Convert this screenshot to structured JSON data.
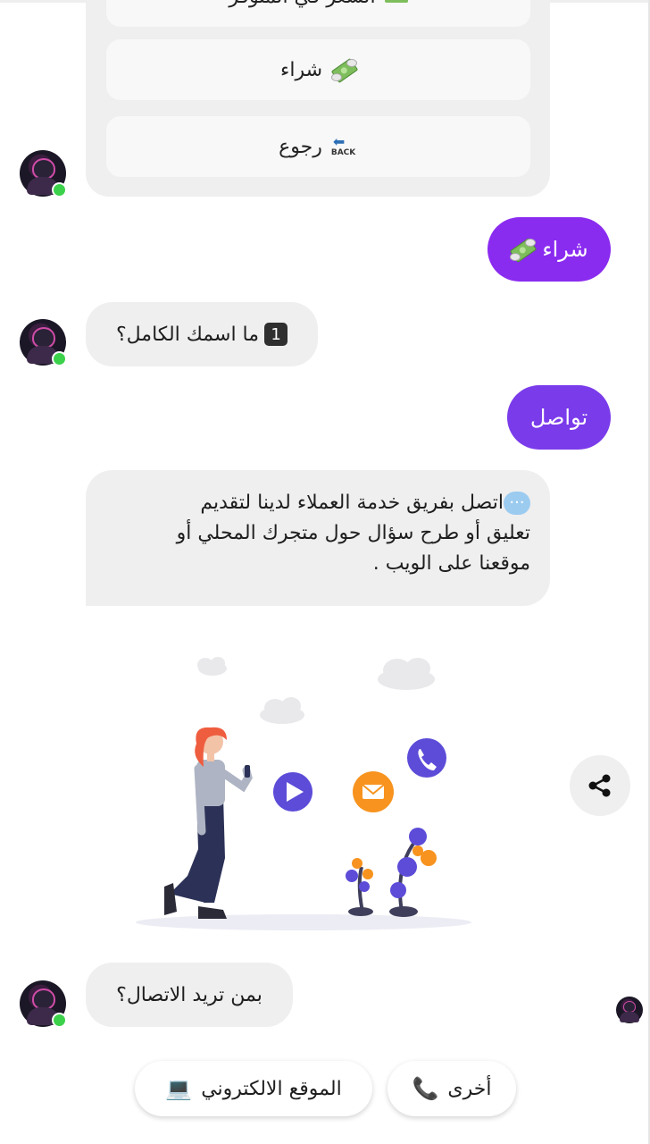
{
  "colors": {
    "outgoing_bubble": "#8a2bf0",
    "incoming_bubble": "#efefef",
    "online_dot": "#3bd14a"
  },
  "menu_card": {
    "partial_item_label": "السعر في المتوفر",
    "items": [
      {
        "label": "شراء",
        "icon": "flying-money-icon"
      },
      {
        "label": "رجوع",
        "icon": "back-arrow-icon"
      }
    ]
  },
  "messages": [
    {
      "from": "user",
      "text": "شراء",
      "icon": "flying-money-icon"
    },
    {
      "from": "bot",
      "text": "ما اسمك الكامل؟",
      "badge": "1"
    },
    {
      "from": "user",
      "text": "تواصل"
    },
    {
      "from": "bot",
      "text_lines": [
        "اتصل بفريق خدمة العملاء لدينا لتقديم",
        "تعليق أو طرح سؤال حول متجرك المحلي أو",
        "موقعنا على الويب ."
      ],
      "icon": "speech-bubble-icon"
    },
    {
      "from": "bot",
      "text": "بمن تريد الاتصال؟"
    }
  ],
  "quick_replies": [
    {
      "label": "أخرى",
      "icon": "telephone-icon"
    },
    {
      "label": "الموقع الالكتروني",
      "icon": "laptop-icon"
    }
  ],
  "share": {
    "icon": "share-icon"
  }
}
